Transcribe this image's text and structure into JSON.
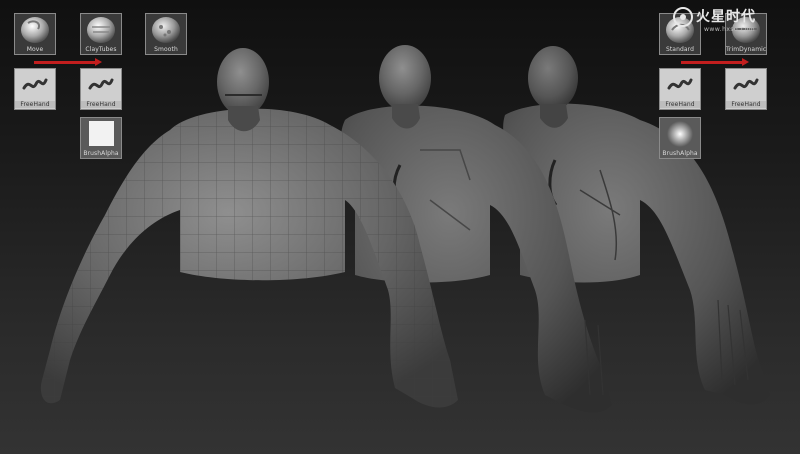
{
  "watermark": {
    "brand": "火星时代",
    "url": "www.hxsd.com"
  },
  "left_panel": {
    "tools": [
      {
        "label": "Move",
        "icon": "move-brush-icon"
      },
      {
        "label": "ClayTubes",
        "icon": "claytubes-brush-icon"
      },
      {
        "label": "Smooth",
        "icon": "smooth-brush-icon"
      }
    ],
    "strokes": [
      {
        "label": "FreeHand",
        "icon": "freehand-stroke-icon"
      },
      {
        "label": "FreeHand",
        "icon": "freehand-stroke-icon"
      }
    ],
    "alpha": {
      "label": "BrushAlpha",
      "icon": "brush-alpha-icon"
    }
  },
  "right_panel": {
    "tools": [
      {
        "label": "Standard",
        "icon": "standard-brush-icon"
      },
      {
        "label": "TrimDynamic",
        "icon": "trimdynamic-brush-icon"
      }
    ],
    "strokes": [
      {
        "label": "FreeHand",
        "icon": "freehand-stroke-icon"
      },
      {
        "label": "FreeHand",
        "icon": "freehand-stroke-icon"
      }
    ],
    "alpha": {
      "label": "BrushAlpha",
      "icon": "brush-alpha-icon"
    }
  },
  "colors": {
    "arrow": "#c21e1e",
    "tile_border": "#8a8a8a"
  }
}
